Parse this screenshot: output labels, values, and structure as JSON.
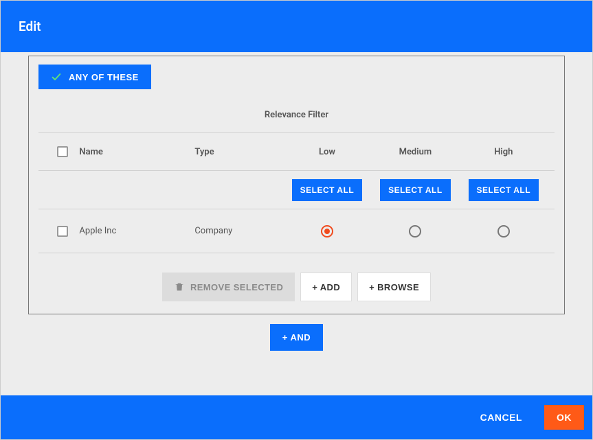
{
  "dialog": {
    "title": "Edit"
  },
  "filter": {
    "any_label": "ANY OF THESE",
    "relevance_title": "Relevance Filter",
    "columns": {
      "name": "Name",
      "type": "Type",
      "low": "Low",
      "medium": "Medium",
      "high": "High"
    },
    "select_all_label": "SELECT ALL",
    "rows": [
      {
        "name": "Apple Inc",
        "type": "Company",
        "selected_level": "low"
      }
    ],
    "actions": {
      "remove_selected": "REMOVE SELECTED",
      "add": "+ ADD",
      "browse": "+ BROWSE"
    }
  },
  "and_label": "+ AND",
  "footer": {
    "cancel": "CANCEL",
    "ok": "OK"
  }
}
